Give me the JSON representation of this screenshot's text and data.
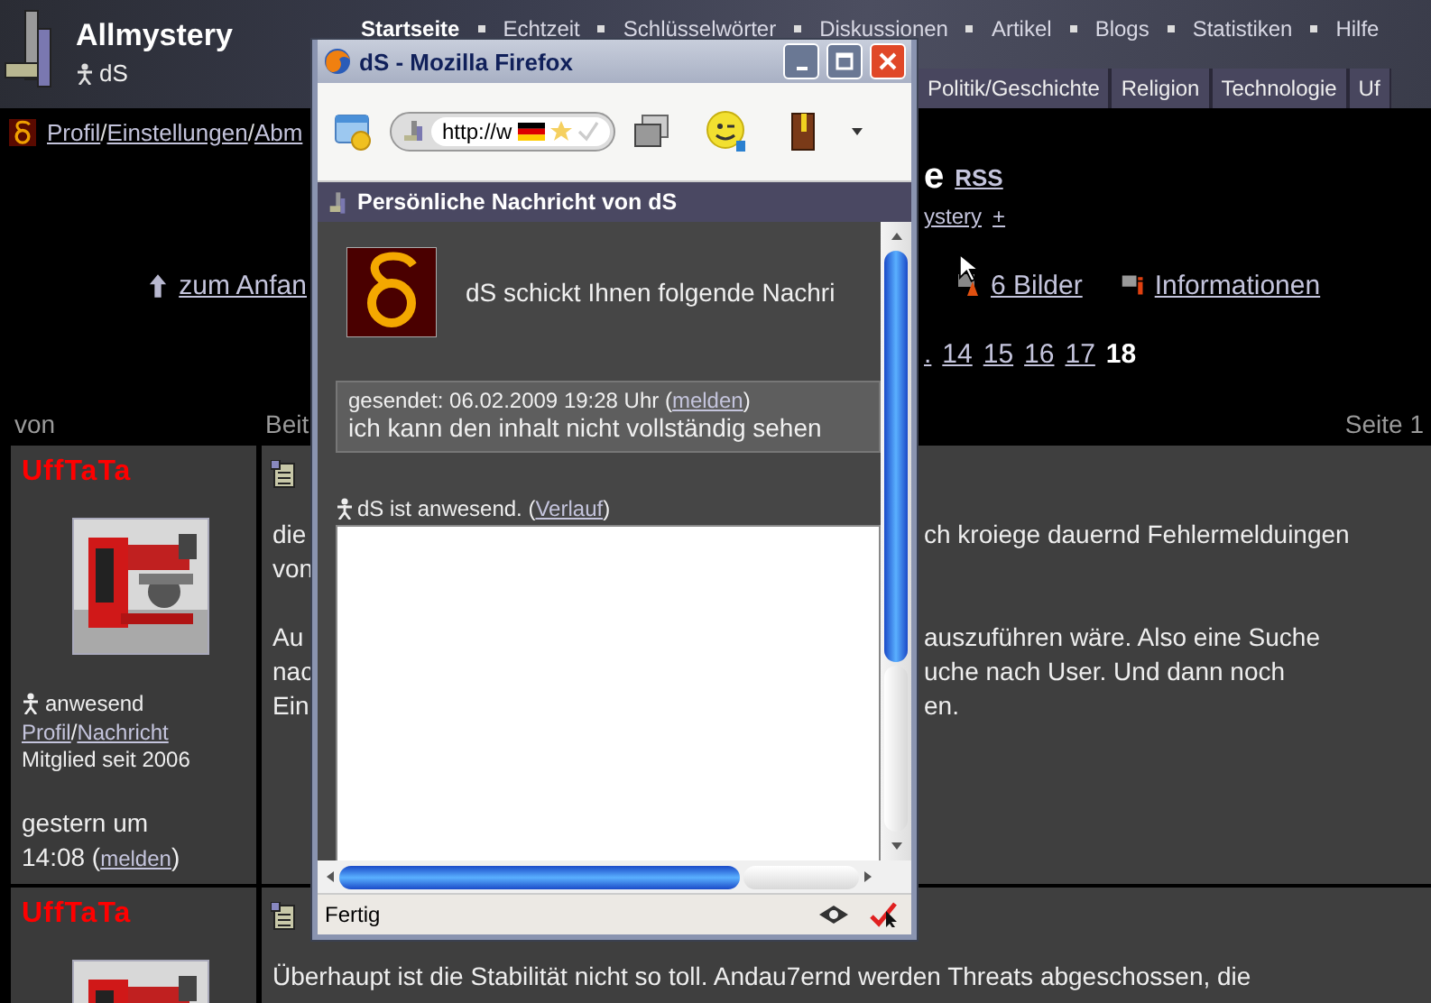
{
  "header": {
    "site_title": "Allmystery",
    "user": "dS",
    "nav": [
      {
        "label": "Startseite",
        "selected": true
      },
      {
        "label": "Echtzeit",
        "selected": false
      },
      {
        "label": "Schlüsselwörter",
        "selected": false
      },
      {
        "label": "Diskussionen",
        "selected": false
      },
      {
        "label": "Artikel",
        "selected": false
      },
      {
        "label": "Blogs",
        "selected": false
      },
      {
        "label": "Statistiken",
        "selected": false
      },
      {
        "label": "Hilfe",
        "selected": false
      }
    ],
    "tabs": [
      "Politik/Geschichte",
      "Religion",
      "Technologie",
      "Uf"
    ]
  },
  "breadcrumb": {
    "links": [
      "Profil",
      "Einstellungen",
      "Abm"
    ],
    "separator": "/"
  },
  "title": {
    "text": "e",
    "rss": "RSS",
    "sub_link": "ystery",
    "plus": "+"
  },
  "actions": {
    "top_link": "zum Anfan",
    "images": "6 Bilder",
    "info": "Informationen"
  },
  "pagination": [
    {
      "label": ".",
      "selected": false
    },
    {
      "label": "14",
      "selected": false
    },
    {
      "label": "15",
      "selected": false
    },
    {
      "label": "16",
      "selected": false
    },
    {
      "label": "17",
      "selected": false
    },
    {
      "label": "18",
      "selected": true
    }
  ],
  "columns": {
    "author": "von",
    "post": "Beit",
    "page": "Seite 1"
  },
  "posts": [
    {
      "author": "UffTaTa",
      "status": "anwesend",
      "links": [
        "Profil",
        "Nachricht"
      ],
      "separator": "/",
      "member_since": "Mitglied seit 2006",
      "date": "gestern um",
      "time": "14:08 (",
      "report": "melden",
      "time_end": ")",
      "paragraphs": [
        [
          {
            "left": "die",
            "right": "ch kroiege dauernd Fehlermelduingen"
          },
          {
            "left": "von"
          }
        ],
        [
          {
            "left": "Au",
            "right": "auszuführen wäre. Also eine Suche"
          },
          {
            "left": "nac",
            "right": "uche nach User. Und dann noch"
          },
          {
            "left": "Ein",
            "right": "en."
          }
        ]
      ]
    },
    {
      "author": "UffTaTa",
      "paragraphs": [
        [
          {
            "full": "Überhaupt ist die Stabilität nicht so toll. Andau7ernd werden Threats abgeschossen, die"
          }
        ]
      ]
    }
  ],
  "popup": {
    "title": "dS - Mozilla Firefox",
    "url": "http://w",
    "header": "Persönliche Nachricht von dS",
    "intro": "dS schickt Ihnen folgende Nachri",
    "message": {
      "prefix": "gesendet: 06.02.2009 19:28 Uhr (",
      "link": "melden",
      "suffix": ")",
      "text": "ich kann den inhalt nicht vollständig sehen"
    },
    "presence": {
      "prefix": "dS ist anwesend. (",
      "link": "Verlauf",
      "suffix": ")"
    },
    "status": "Fertig"
  }
}
